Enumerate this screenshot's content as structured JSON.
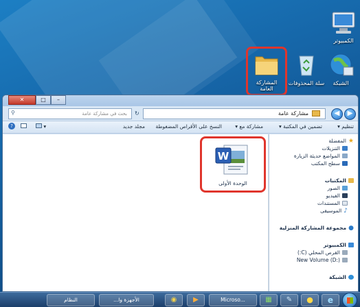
{
  "desktop": {
    "icons": [
      {
        "label": "الكمبيوتر"
      },
      {
        "label": "سلة المحذوفات"
      },
      {
        "label": "الشبكة"
      },
      {
        "label": "المشاركة العامة"
      }
    ]
  },
  "window": {
    "controls": {
      "minimize": "–",
      "maximize": "□",
      "close": "✕"
    },
    "address": {
      "path": "مشاركة عامة",
      "back": "◀",
      "forward": "▶"
    },
    "search": {
      "placeholder": "بحث في مشاركة عامة"
    },
    "toolbar": {
      "organize": "تنظيم ▾",
      "include_in_library": "تضمين في المكتبة ▾",
      "share_with": "مشاركة مع ▾",
      "burn": "النسخ على الأقراص المضغوطة",
      "new_folder": "مجلد جديد",
      "view": "▾"
    },
    "navpane": {
      "favorites": "المفضلة",
      "downloads": "التنزيلات",
      "recent_places": "المواضع حديثة الزيارة",
      "desktop": "سطح المكتب",
      "libraries": "المكتبات",
      "pictures": "الصور",
      "videos": "الفيديو",
      "documents": "المستندات",
      "music": "الموسيقى",
      "homegroup": "مجموعة المشاركة المنزلية",
      "computer": "الكمبيوتر",
      "local_disk": "القرص المحلي (C:)",
      "new_volume": "New Volume (D:)",
      "network": "الشبكة"
    },
    "file": {
      "name": "الوحدة الأولى"
    }
  },
  "taskbar": {
    "task_1": "النظام",
    "task_2": "الأجهزة وا...",
    "task_3": "Microso..."
  },
  "colors": {
    "highlight": "#e0352c",
    "window_frame": "#cfe0f2",
    "taskbar": "#1c3f6a"
  }
}
